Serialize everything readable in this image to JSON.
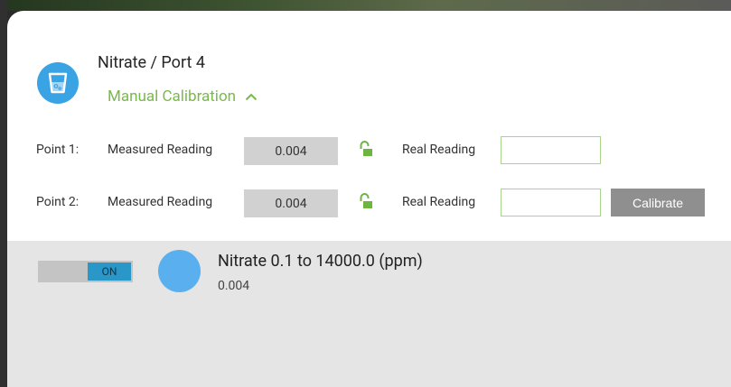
{
  "header": {
    "title": "Nitrate / Port 4",
    "calibration_toggle": "Manual Calibration"
  },
  "calibration": {
    "points": [
      {
        "label": "Point 1:",
        "measured_label": "Measured Reading",
        "measured_value": "0.004",
        "real_label": "Real Reading",
        "real_value": ""
      },
      {
        "label": "Point 2:",
        "measured_label": "Measured Reading",
        "measured_value": "0.004",
        "real_label": "Real Reading",
        "real_value": ""
      }
    ],
    "calibrate_button": "Calibrate"
  },
  "sensor": {
    "switch_label": "ON",
    "name": "Nitrate 0.1 to 14000.0 (ppm)",
    "reading": "0.004"
  },
  "colors": {
    "accent_green": "#78b94b",
    "icon_blue": "#3aa3e3",
    "switch_on": "#2a97c9",
    "sensor_dot": "#5ab0ef"
  }
}
